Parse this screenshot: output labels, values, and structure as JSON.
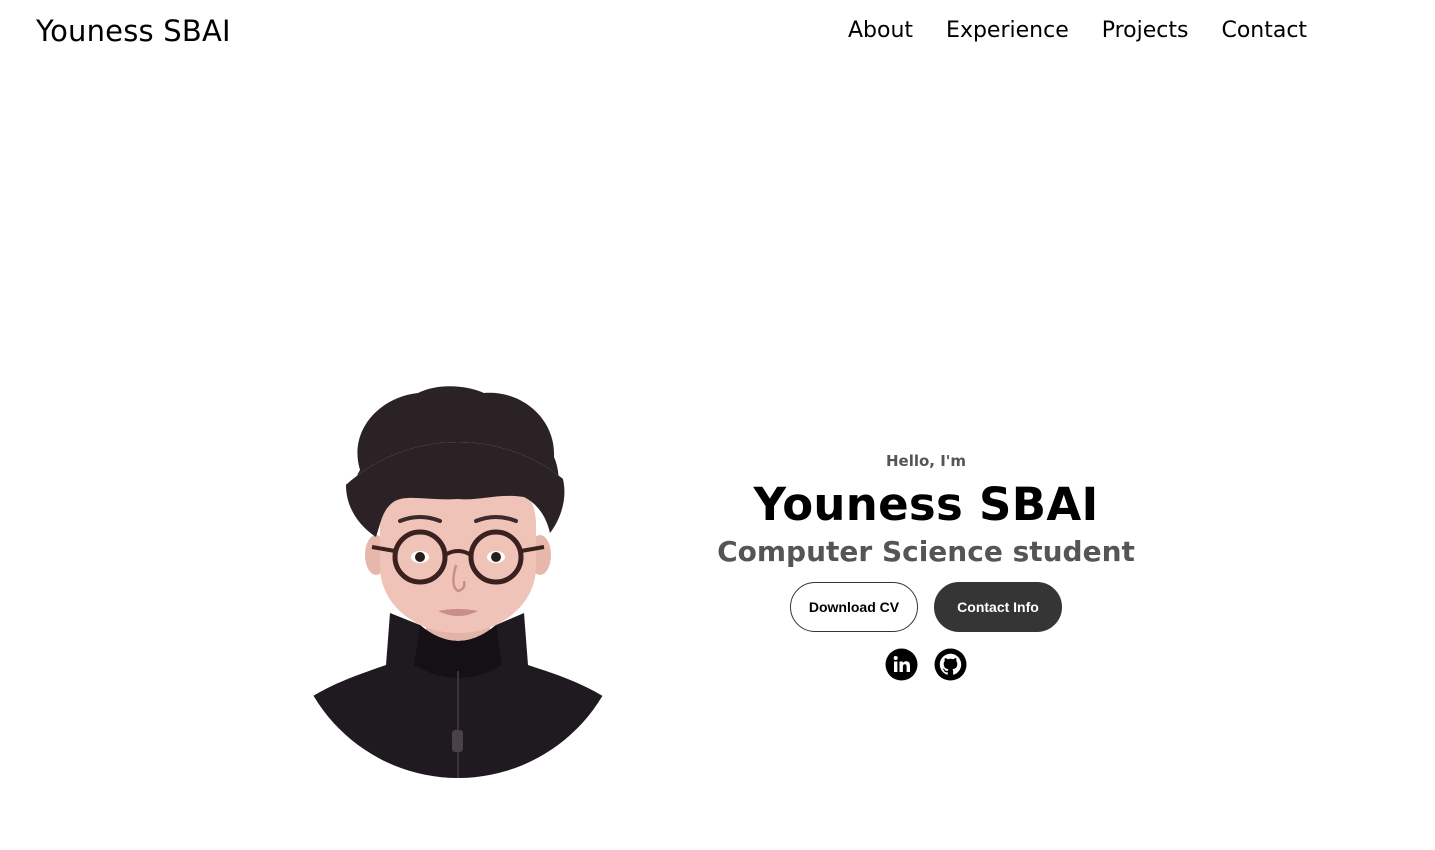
{
  "nav": {
    "logo": "Youness SBAI",
    "links": [
      "About",
      "Experience",
      "Projects",
      "Contact"
    ]
  },
  "hero": {
    "greeting": "Hello, I'm",
    "name": "Youness SBAI",
    "role": "Computer Science student",
    "buttons": {
      "download_cv": "Download CV",
      "contact_info": "Contact Info"
    },
    "socials": [
      {
        "icon": "linkedin-icon"
      },
      {
        "icon": "github-icon"
      }
    ]
  },
  "colors": {
    "background": "#ffffff",
    "text": "#000000",
    "muted_text": "#555555",
    "button_dark": "#353535"
  }
}
